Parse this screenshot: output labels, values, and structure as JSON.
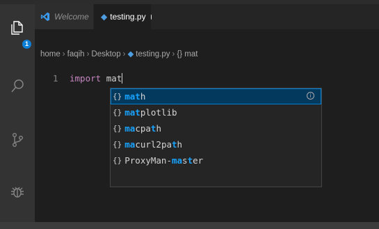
{
  "titlebar": {
    "dots": "···"
  },
  "activity_bar": {
    "items": [
      {
        "name": "explorer",
        "icon": "files-icon"
      },
      {
        "name": "search",
        "icon": "search-icon"
      },
      {
        "name": "source-control",
        "icon": "source-control-icon"
      },
      {
        "name": "debug",
        "icon": "debug-icon"
      }
    ],
    "explorer_badge": "1"
  },
  "tabs": [
    {
      "label": "Welcome",
      "icon": "vscode-logo-icon",
      "active": false
    },
    {
      "label": "testing.py",
      "icon": "python-file-icon",
      "active": true,
      "modified": true
    }
  ],
  "breadcrumb": {
    "parts": [
      "home",
      "faqih",
      "Desktop",
      "testing.py",
      "mat"
    ],
    "symbol_prefix": "{}",
    "separator": "›"
  },
  "editor": {
    "line_number": "1",
    "keyword": "import",
    "typed": "mat"
  },
  "suggestions": {
    "items": [
      {
        "match": "mat",
        "rest": "h",
        "label": "math",
        "selected": true
      },
      {
        "match": "mat",
        "rest": "plotlib",
        "label": "matplotlib",
        "selected": false
      },
      {
        "prefix": "",
        "segments": [
          {
            "t": "ma",
            "h": true
          },
          {
            "t": "cp",
            "h": false
          },
          {
            "t": "a",
            "h": false
          },
          {
            "t": "t",
            "h": true
          },
          {
            "t": "h",
            "h": false
          }
        ],
        "label": "macpath",
        "selected": false
      },
      {
        "prefix": "",
        "segments": [
          {
            "t": "ma",
            "h": true
          },
          {
            "t": "curl2pa",
            "h": false
          },
          {
            "t": "t",
            "h": true
          },
          {
            "t": "h",
            "h": false
          }
        ],
        "label": "macurl2path",
        "selected": false
      },
      {
        "prefix": "ProxyMan-",
        "segments": [
          {
            "t": "ma",
            "h": true
          },
          {
            "t": "s",
            "h": false
          },
          {
            "t": "t",
            "h": true
          },
          {
            "t": "er",
            "h": false
          }
        ],
        "label": "ProxyMan-master",
        "selected": false
      }
    ],
    "kind_icon": "{}",
    "info_icon": "i"
  },
  "colors": {
    "accent": "#0e7fd6",
    "match_highlight": "#18a3ff",
    "selection": "#04395e",
    "keyword": "#c586c0"
  }
}
